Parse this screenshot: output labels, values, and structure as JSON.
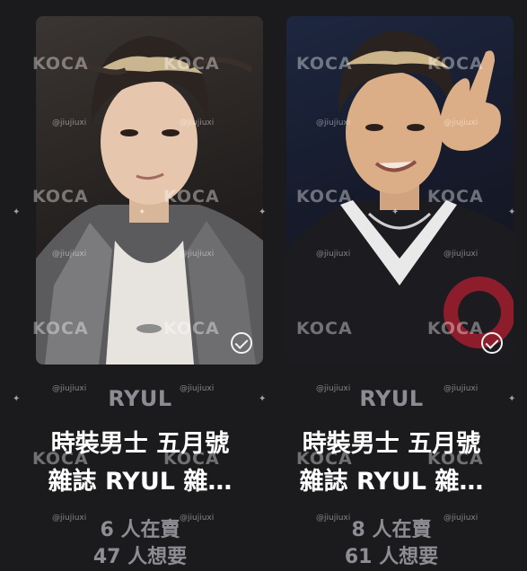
{
  "cards": [
    {
      "artist": "RYUL",
      "title_line1": "時裝男士 五月號",
      "title_line2": "雜誌 RYUL 雜…",
      "selling": "6 人在賣",
      "wanting": "47 人想要"
    },
    {
      "artist": "RYUL",
      "title_line1": "時裝男士 五月號",
      "title_line2": "雜誌 RYUL 雜…",
      "selling": "8 人在賣",
      "wanting": "61 人想要"
    }
  ],
  "watermark": {
    "brand": "KOCA",
    "handle": "@jiujiuxi"
  },
  "icons": {
    "owned_badge": "check-circle-icon"
  },
  "colors": {
    "background": "#1b1b1d",
    "title": "#ffffff",
    "muted": "#8c8c93"
  }
}
